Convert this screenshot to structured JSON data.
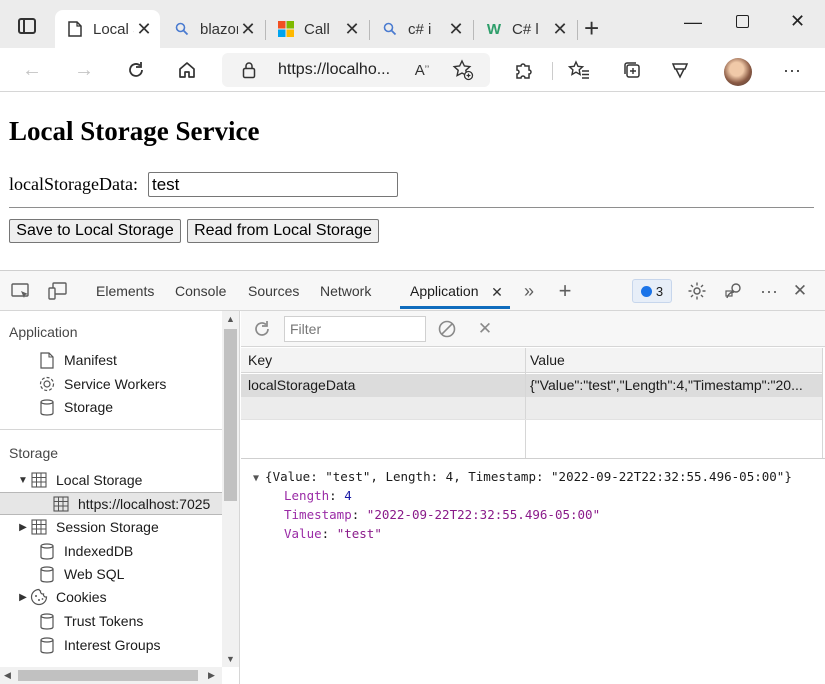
{
  "browser": {
    "tabs": [
      {
        "title": "Local Storage Service",
        "icon": "page-icon",
        "active": true
      },
      {
        "title": "blazor",
        "icon": "search-icon"
      },
      {
        "title": "Call",
        "icon": "microsoft-icon"
      },
      {
        "title": "c# i",
        "icon": "search-icon"
      },
      {
        "title": "C# l",
        "icon": "w-icon"
      }
    ],
    "url": "https://localho...",
    "colors": {
      "tabstrip": "#ececec",
      "accent": "#0f6cbd"
    }
  },
  "page": {
    "title": "Local Storage Service",
    "field_label": "localStorageData:",
    "field_value": "test",
    "save_button": "Save to Local Storage",
    "read_button": "Read from Local Storage"
  },
  "devtools": {
    "tabs": [
      "Elements",
      "Console",
      "Sources",
      "Network",
      "Application"
    ],
    "active_tab": "Application",
    "issues_count": "3",
    "sidebar": {
      "application_header": "Application",
      "application_items": [
        {
          "label": "Manifest",
          "icon": "file-icon"
        },
        {
          "label": "Service Workers",
          "icon": "gear-icon"
        },
        {
          "label": "Storage",
          "icon": "database-icon"
        }
      ],
      "storage_header": "Storage",
      "storage_items": [
        {
          "label": "Local Storage",
          "icon": "grid-icon",
          "expanded": true
        },
        {
          "label": "https://localhost:7025",
          "icon": "grid-icon",
          "selected": true
        },
        {
          "label": "Session Storage",
          "icon": "grid-icon",
          "expanded": false
        },
        {
          "label": "IndexedDB",
          "icon": "database-icon"
        },
        {
          "label": "Web SQL",
          "icon": "database-icon"
        },
        {
          "label": "Cookies",
          "icon": "cookie-icon",
          "expanded": false
        },
        {
          "label": "Trust Tokens",
          "icon": "database-icon"
        },
        {
          "label": "Interest Groups",
          "icon": "database-icon"
        }
      ]
    },
    "filter_placeholder": "Filter",
    "table": {
      "headers": [
        "Key",
        "Value"
      ],
      "rows": [
        {
          "key": "localStorageData",
          "value": "{\"Value\":\"test\",\"Length\":4,\"Timestamp\":\"20..."
        }
      ]
    },
    "preview": {
      "summary": "{Value: \"test\", Length: 4, Timestamp: \"2022-09-22T22:32:55.496-05:00\"}",
      "props": [
        {
          "name": "Length",
          "value": "4",
          "kind": "number"
        },
        {
          "name": "Timestamp",
          "value": "\"2022-09-22T22:32:55.496-05:00\"",
          "kind": "string"
        },
        {
          "name": "Value",
          "value": "\"test\"",
          "kind": "string"
        }
      ]
    }
  }
}
